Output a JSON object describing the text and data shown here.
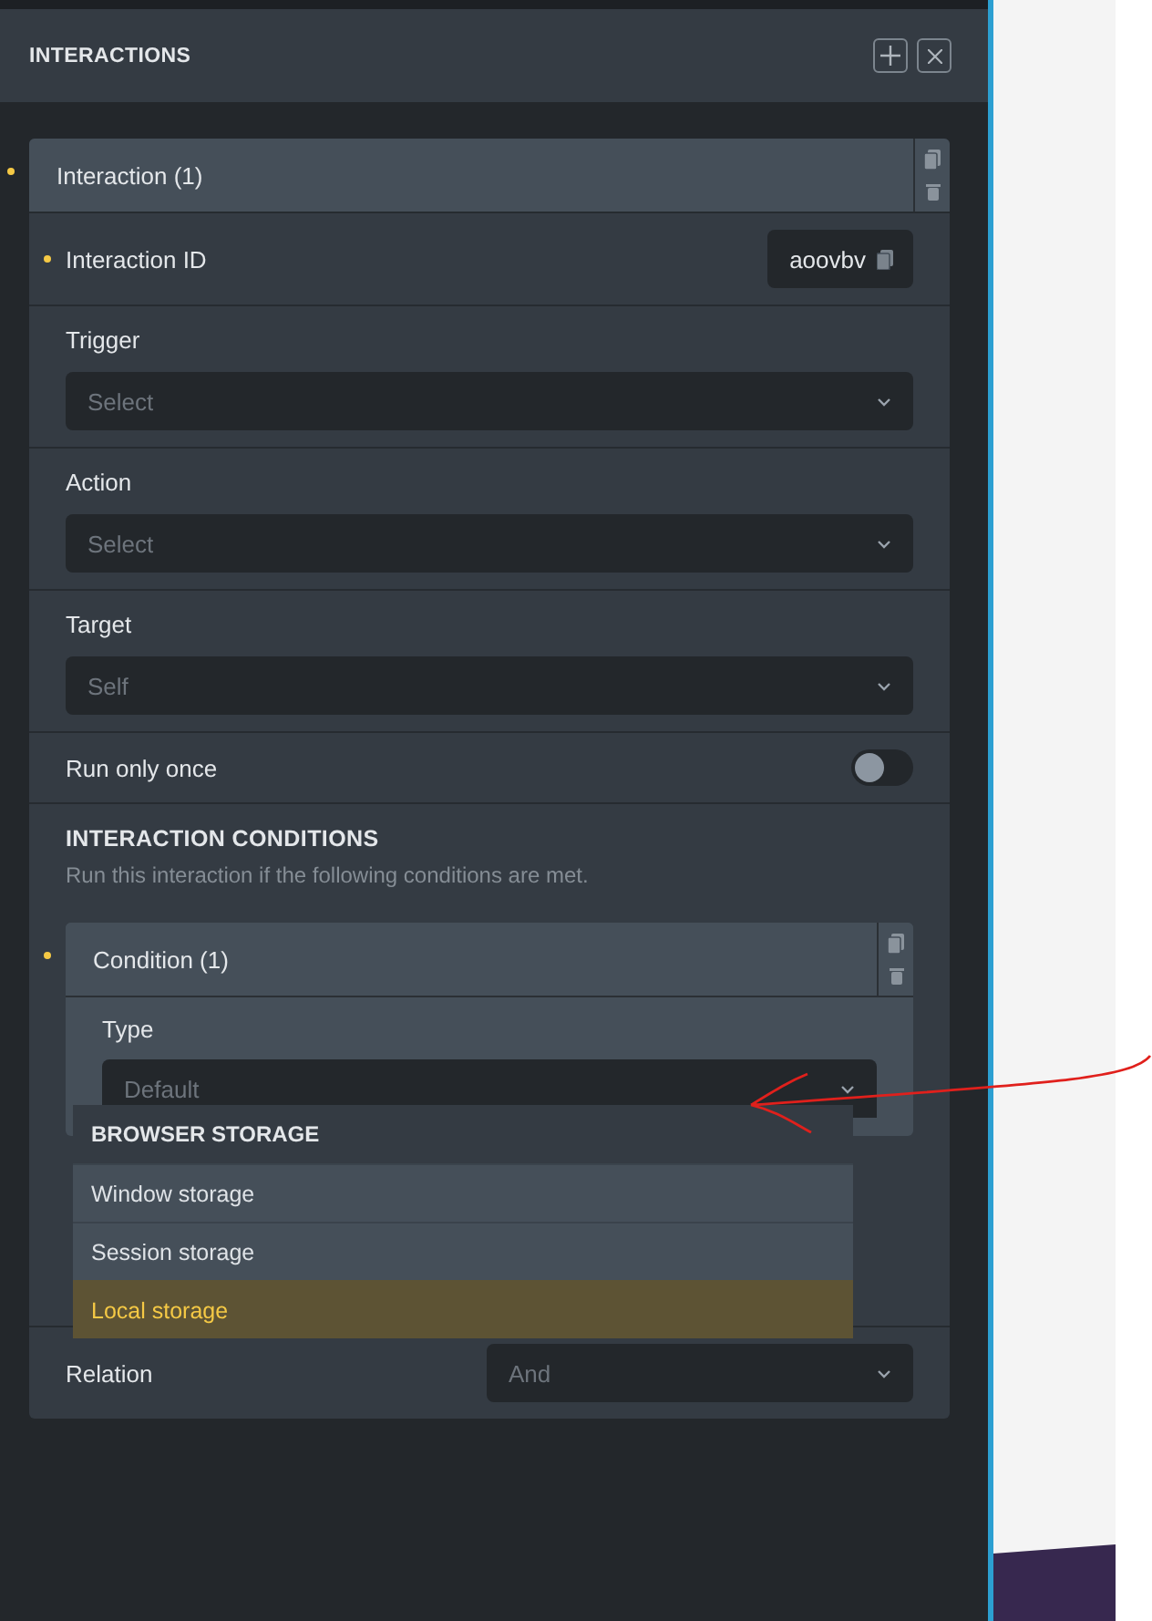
{
  "panel": {
    "title": "INTERACTIONS"
  },
  "interaction": {
    "title": "Interaction (1)",
    "modified": true,
    "id_field": {
      "label": "Interaction ID",
      "value": "aoovbv",
      "modified": true
    },
    "fields": [
      {
        "label": "Trigger",
        "placeholder": "Select"
      },
      {
        "label": "Action",
        "placeholder": "Select"
      },
      {
        "label": "Target",
        "placeholder": "Self"
      }
    ],
    "run_only_once": {
      "label": "Run only once",
      "on": false
    },
    "conditions": {
      "title": "INTERACTION CONDITIONS",
      "description": "Run this interaction if the following conditions are met.",
      "items": [
        {
          "title": "Condition (1)",
          "modified": true,
          "type": {
            "label": "Type",
            "placeholder": "Default",
            "expanded": true
          }
        }
      ],
      "relation": {
        "label": "Relation",
        "placeholder": "And"
      }
    }
  },
  "dropdown": {
    "group": "BROWSER STORAGE",
    "options": [
      {
        "label": "Window storage",
        "selected": false
      },
      {
        "label": "Session storage",
        "selected": false
      },
      {
        "label": "Local storage",
        "selected": true
      }
    ]
  }
}
